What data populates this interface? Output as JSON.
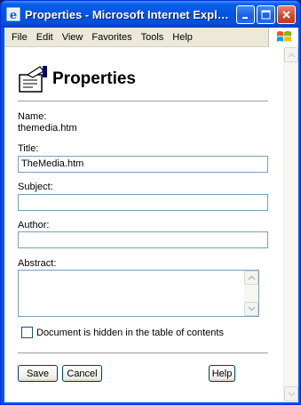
{
  "window": {
    "title": "Properties - Microsoft Internet Expl…",
    "controls": [
      "minimize-icon",
      "maximize-icon",
      "close-icon"
    ]
  },
  "menu": {
    "items": [
      "File",
      "Edit",
      "View",
      "Favorites",
      "Tools",
      "Help"
    ]
  },
  "page": {
    "title": "Properties",
    "name_label": "Name:",
    "name_value": "themedia.htm",
    "title_label": "Title:",
    "title_value": "TheMedia.htm",
    "subject_label": "Subject:",
    "subject_value": "",
    "author_label": "Author:",
    "author_value": "",
    "abstract_label": "Abstract:",
    "abstract_value": "",
    "hidden_checkbox_label": "Document is hidden in the table of contents",
    "hidden_checked": false
  },
  "buttons": {
    "save": "Save",
    "cancel": "Cancel",
    "help": "Help"
  },
  "colors": {
    "titlebar": "#0054e3",
    "menubar": "#ece9d8",
    "field_border": "#7f9db9"
  }
}
